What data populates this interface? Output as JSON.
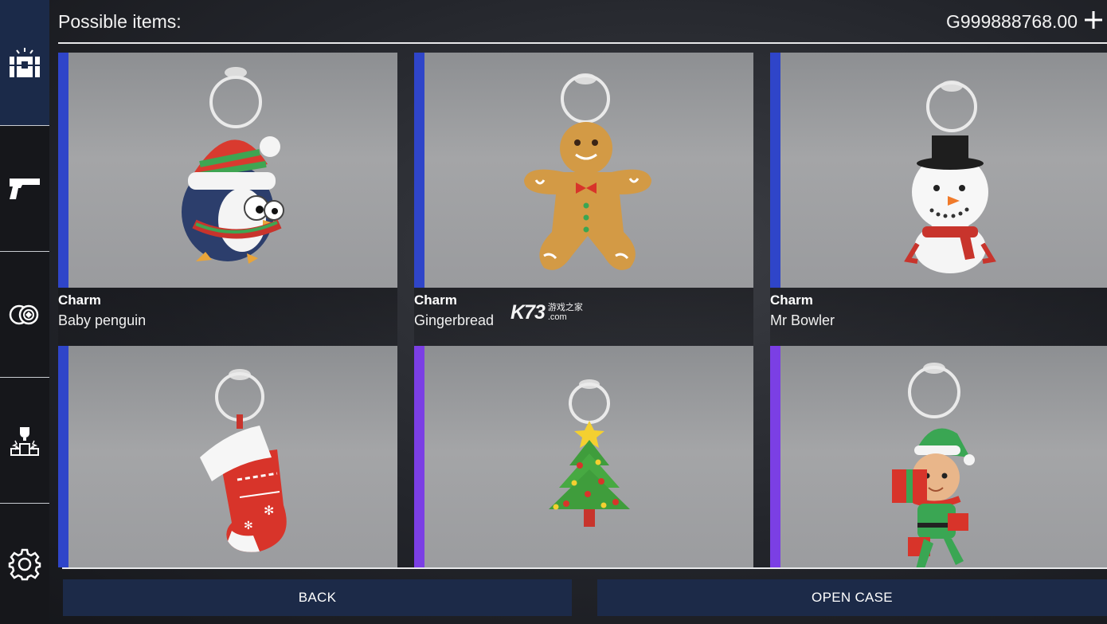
{
  "header": {
    "title": "Possible items:",
    "currency": "G999888768.00"
  },
  "sidebar": {
    "items": [
      {
        "name": "cases",
        "icon": "chest-icon",
        "active": true
      },
      {
        "name": "weapons",
        "icon": "pistol-icon",
        "active": false
      },
      {
        "name": "coins",
        "icon": "coins-icon",
        "active": false
      },
      {
        "name": "leaderboard",
        "icon": "trophy-podium-icon",
        "active": false
      },
      {
        "name": "settings",
        "icon": "gear-icon",
        "active": false
      }
    ]
  },
  "items": [
    {
      "category": "Charm",
      "name": "Baby penguin",
      "rarity_color": "#2f45c9"
    },
    {
      "category": "Charm",
      "name": "Gingerbread",
      "rarity_color": "#2f45c9"
    },
    {
      "category": "Charm",
      "name": "Mr Bowler",
      "rarity_color": "#2f45c9"
    },
    {
      "category": "",
      "name": "",
      "rarity_color": "#2f45c9"
    },
    {
      "category": "",
      "name": "",
      "rarity_color": "#7b3fe4"
    },
    {
      "category": "",
      "name": "",
      "rarity_color": "#7b3fe4"
    }
  ],
  "buttons": {
    "back": "BACK",
    "open_case": "OPEN CASE"
  },
  "watermark": {
    "main": "K73",
    "sub_top": "游戏之家",
    "sub_bottom": ".com"
  },
  "colors": {
    "sidebar_active": "#1b2a49",
    "button_bg": "#1c2a48",
    "rarity_blue": "#2f45c9",
    "rarity_purple": "#7b3fe4"
  }
}
